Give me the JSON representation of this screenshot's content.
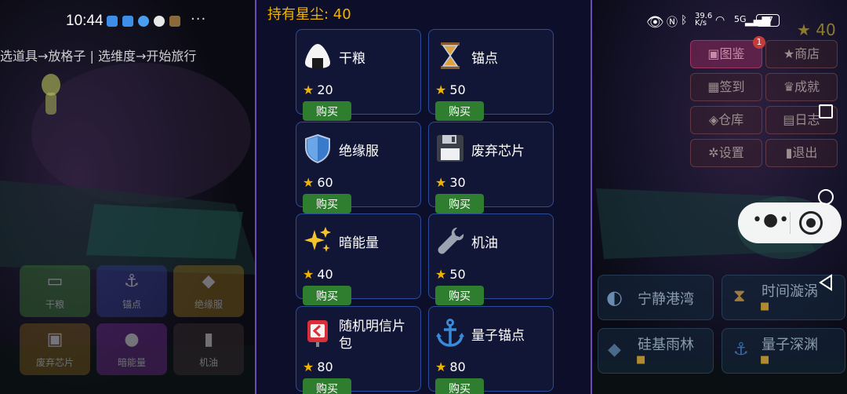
{
  "status_bar": {
    "time": "10:44",
    "more": "···",
    "net_speed_top": "39.6",
    "net_speed_bottom": "K/s",
    "signal": "5G",
    "battery": "47"
  },
  "hint_text": "选道具→放格子 | 选维度→开始旅行",
  "left_inventory": [
    {
      "icon": "rice-ball-icon",
      "label": "干粮"
    },
    {
      "icon": "hourglass-icon",
      "label": "锚点"
    },
    {
      "icon": "shield-icon",
      "label": "绝缘服"
    },
    {
      "icon": "floppy-icon",
      "label": "废弃芯片"
    },
    {
      "icon": "sparkles-icon",
      "label": "暗能量"
    },
    {
      "icon": "wrench-icon",
      "label": "机油"
    }
  ],
  "shop": {
    "stardust_label": "持有星尘: 40",
    "buy_label": "购买",
    "items": [
      {
        "name": "干粮",
        "price": "20",
        "icon": "rice-ball-icon"
      },
      {
        "name": "锚点",
        "price": "50",
        "icon": "hourglass-icon"
      },
      {
        "name": "绝缘服",
        "price": "60",
        "icon": "shield-icon"
      },
      {
        "name": "废弃芯片",
        "price": "30",
        "icon": "floppy-disk-icon"
      },
      {
        "name": "暗能量",
        "price": "40",
        "icon": "sparkles-icon"
      },
      {
        "name": "机油",
        "price": "50",
        "icon": "wrench-icon"
      },
      {
        "name": "随机明信片包",
        "price": "80",
        "icon": "postcard-icon"
      },
      {
        "name": "量子锚点",
        "price": "80",
        "icon": "anchor-icon"
      }
    ]
  },
  "right_panel": {
    "star_count": "40",
    "badge_count": "1",
    "menu": [
      {
        "label": "图鉴",
        "icon": "book-icon"
      },
      {
        "label": "商店",
        "icon": "star-icon"
      },
      {
        "label": "签到",
        "icon": "calendar-icon"
      },
      {
        "label": "成就",
        "icon": "trophy-icon"
      },
      {
        "label": "仓库",
        "icon": "box-icon"
      },
      {
        "label": "日志",
        "icon": "journal-icon"
      },
      {
        "label": "设置",
        "icon": "gear-icon"
      },
      {
        "label": "退出",
        "icon": "door-icon"
      }
    ],
    "destinations": [
      {
        "label": "宁静港湾",
        "locked": false
      },
      {
        "label": "时间漩涡",
        "locked": true
      },
      {
        "label": "硅基雨林",
        "locked": true
      },
      {
        "label": "量子深渊",
        "locked": true
      }
    ]
  },
  "colors": {
    "accent_gold": "#f0b400",
    "buy_green": "#2f7d2f",
    "card_border": "#2c4d99",
    "panel_border": "#6e4cb8"
  }
}
